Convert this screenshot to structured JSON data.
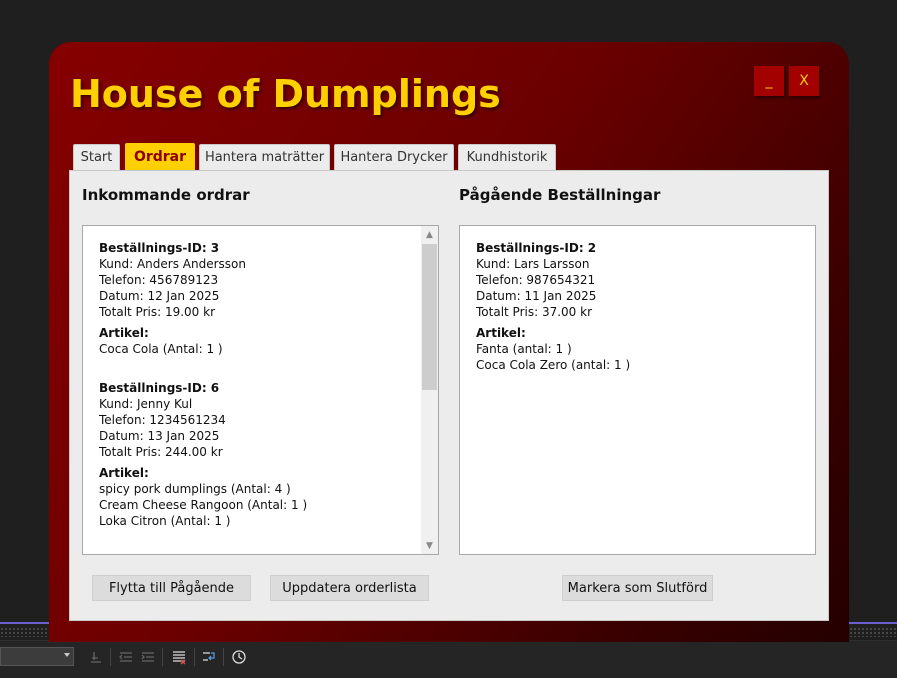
{
  "window": {
    "title": "House of Dumplings",
    "minimize_label": "_",
    "close_label": "X"
  },
  "tabs": [
    {
      "label": "Start",
      "active": false
    },
    {
      "label": "Ordrar",
      "active": true
    },
    {
      "label": "Hantera maträtter",
      "active": false
    },
    {
      "label": "Hantera Drycker",
      "active": false
    },
    {
      "label": "Kundhistorik",
      "active": false
    }
  ],
  "incoming": {
    "title": "Inkommande ordrar",
    "orders": [
      {
        "id_line": "Beställnings-ID: 3",
        "customer": "Kund: Anders Andersson",
        "phone": "Telefon: 456789123",
        "date": "Datum: 12 Jan 2025",
        "total": "Totalt Pris: 19.00 kr",
        "items_label": "Artikel:",
        "items": [
          "Coca Cola  (Antal:  1 )"
        ]
      },
      {
        "id_line": "Beställnings-ID: 6",
        "customer": "Kund: Jenny Kul",
        "phone": "Telefon: 1234561234",
        "date": "Datum: 13 Jan 2025",
        "total": "Totalt Pris: 244.00 kr",
        "items_label": "Artikel:",
        "items": [
          "spicy pork dumplings  (Antal:  4 )",
          "Cream Cheese Rangoon  (Antal:  1 )",
          "Loka Citron  (Antal:  1 )"
        ]
      }
    ],
    "scroll_fraction": 0.45
  },
  "ongoing": {
    "title": "Pågående Beställningar",
    "orders": [
      {
        "id_line": "Beställnings-ID: 2",
        "customer": "Kund: Lars Larsson",
        "phone": "Telefon: 987654321",
        "date": "Datum: 11 Jan 2025",
        "total": "Totalt Pris: 37.00 kr",
        "items_label": "Artikel:",
        "items": [
          "Fanta  (antal:  1 )",
          "Coca Cola Zero  (antal:  1 )"
        ]
      }
    ]
  },
  "buttons": {
    "move_to_ongoing": "Flytta till Pågående",
    "refresh_orders": "Uppdatera orderlista",
    "mark_completed": "Markera som Slutförd"
  },
  "colors": {
    "title": "#ffd000",
    "window_dark_red": "#860000",
    "active_tab": "#ffd000",
    "active_tab_text": "#8b0000"
  }
}
